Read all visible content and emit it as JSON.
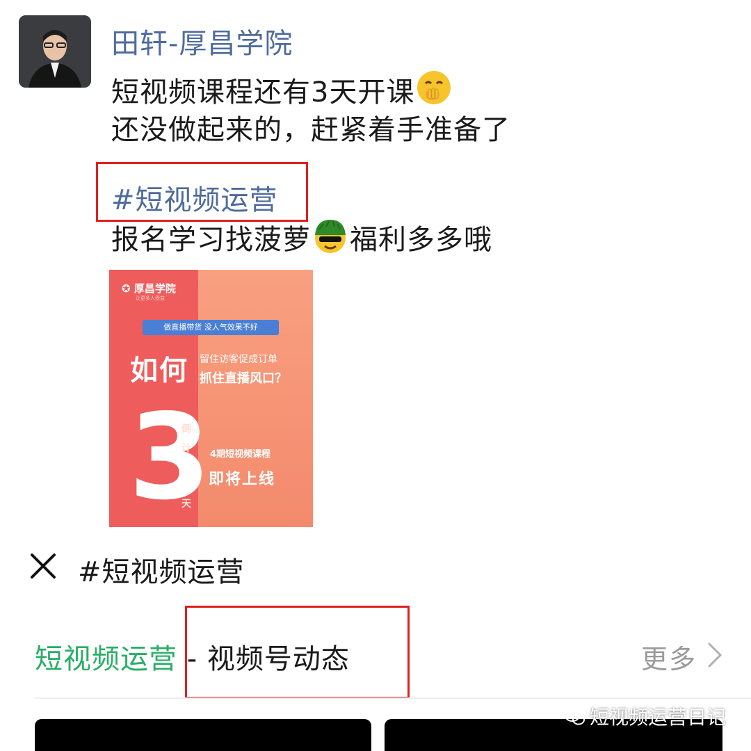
{
  "post": {
    "author": "田轩-厚昌学院",
    "line1": "短视频课程还有3天开课",
    "line2": "还没做起来的，赶紧着手准备了",
    "hashtag": "#短视频运营",
    "line3_a": "报名学习找菠萝",
    "line3_b": "福利多多哦",
    "emoji1": "shushing-face-emoji",
    "emoji2": "green-cap-emoji"
  },
  "poster": {
    "logo": "厚昌学院",
    "logo_sub": "让更多人受益",
    "pill": "做直播带货 没人气效果不好",
    "big": "如何",
    "q1": "留住访客促成订单",
    "q2": "抓住直播风口？",
    "three": "3",
    "small_top": "倒",
    "small_mid": "计",
    "small_bot": "天",
    "course": "4期短视频课程",
    "online": "即将上线"
  },
  "panel": {
    "title": "#短视频运营",
    "section_green": "短视频运营",
    "section_dark": " - 视频号动态",
    "more": "更多"
  },
  "watermark": "短视频运营日记",
  "colors": {
    "link_blue": "#4f6b9c",
    "green": "#2aae67",
    "highlight_red": "#e02020"
  }
}
